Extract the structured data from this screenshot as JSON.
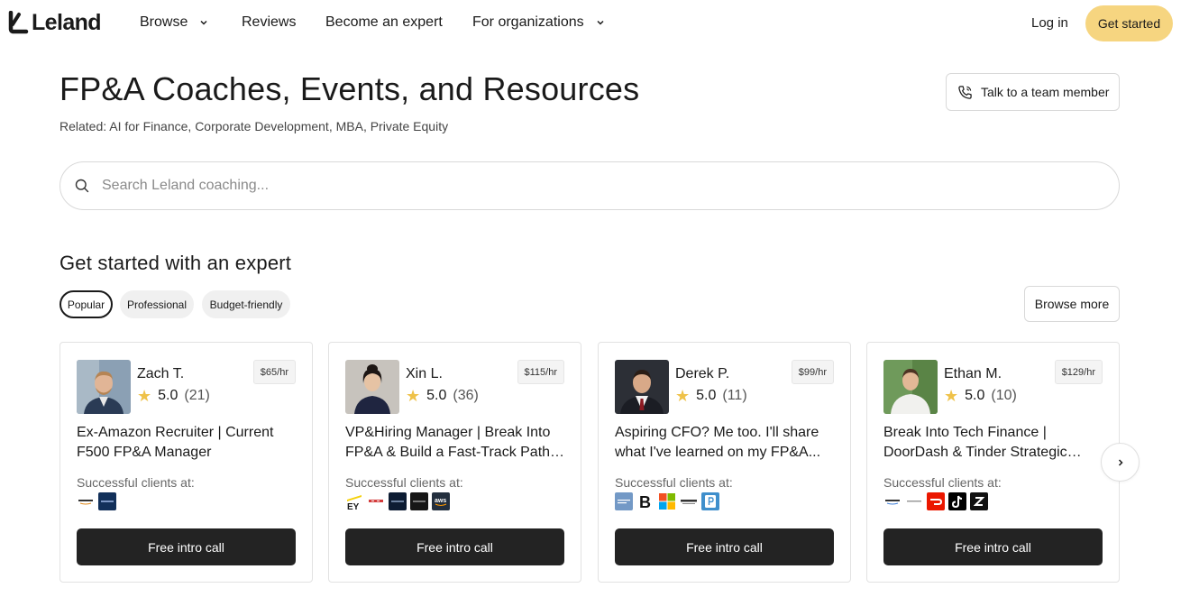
{
  "nav": {
    "logo_text": "Leland",
    "items": [
      {
        "label": "Browse",
        "has_dropdown": true
      },
      {
        "label": "Reviews",
        "has_dropdown": false
      },
      {
        "label": "Become an expert",
        "has_dropdown": false
      },
      {
        "label": "For organizations",
        "has_dropdown": true
      }
    ],
    "login_label": "Log in",
    "cta_label": "Get started",
    "cta_color": "#f6d580"
  },
  "header": {
    "title": "FP&A Coaches, Events, and Resources",
    "related": "Related: AI for Finance, Corporate Development, MBA, Private Equity",
    "talk_label": "Talk to a team member"
  },
  "search": {
    "placeholder": "Search Leland coaching..."
  },
  "section": {
    "title": "Get started with an expert",
    "chips": [
      {
        "label": "Popular",
        "active": true
      },
      {
        "label": "Professional",
        "active": false
      },
      {
        "label": "Budget-friendly",
        "active": false
      }
    ],
    "browse_more_label": "Browse more"
  },
  "cards": [
    {
      "name": "Zach T.",
      "rating": "5.0",
      "reviews": "(21)",
      "price": "$65/hr",
      "headline": "Ex-Amazon Recruiter | Current F500 FP&A Manager",
      "clients_label": "Successful clients at:",
      "client_logos": [
        "amazon-logo",
        "navy-company-logo"
      ],
      "cta_label": "Free intro call"
    },
    {
      "name": "Xin L.",
      "rating": "5.0",
      "reviews": "(36)",
      "price": "$115/hr",
      "headline": "VP&Hiring Manager | Break Into FP&A & Build a Fast-Track Path to...",
      "clients_label": "Successful clients at:",
      "client_logos": [
        "ey-logo",
        "red-company-logo",
        "navy-company-logo",
        "dark-company-logo",
        "aws-logo"
      ],
      "cta_label": "Free intro call"
    },
    {
      "name": "Derek P.",
      "rating": "5.0",
      "reviews": "(11)",
      "price": "$99/hr",
      "headline": "Aspiring CFO? Me too. I'll share what I've learned on my FP&A...",
      "clients_label": "Successful clients at:",
      "client_logos": [
        "goldman-sachs-logo",
        "b-logo",
        "microsoft-logo",
        "zions-logo",
        "p-logo"
      ],
      "cta_label": "Free intro call"
    },
    {
      "name": "Ethan M.",
      "rating": "5.0",
      "reviews": "(10)",
      "price": "$129/hr",
      "headline": "Break Into Tech Finance | DoorDash & Tinder Strategic Finance...",
      "clients_label": "Successful clients at:",
      "client_logos": [
        "amazon-logo",
        "grey-company-logo",
        "doordash-logo",
        "tiktok-logo",
        "z-logo"
      ],
      "cta_label": "Free intro call"
    }
  ]
}
